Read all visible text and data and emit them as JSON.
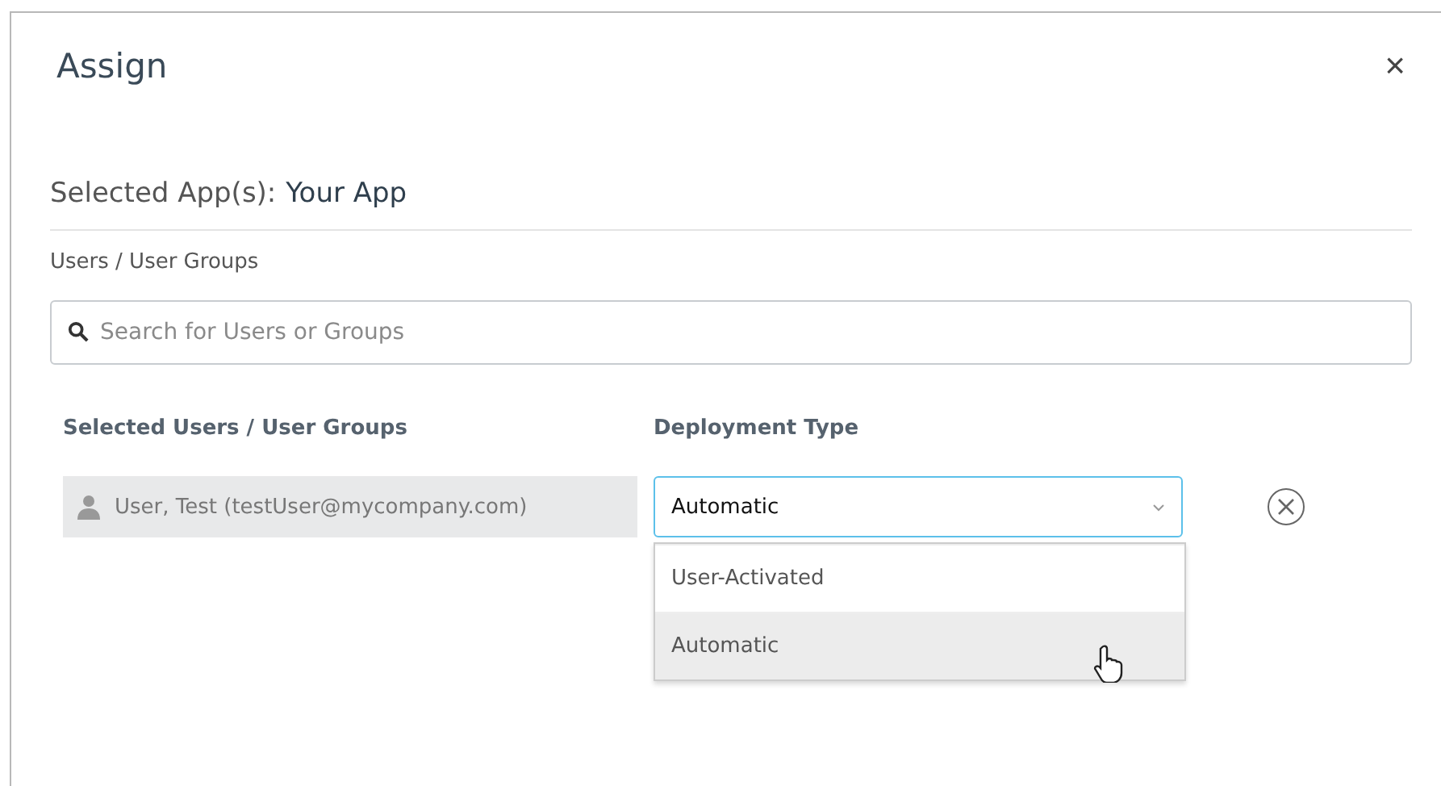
{
  "dialog": {
    "title": "Assign",
    "close": "×"
  },
  "selected_apps": {
    "label": "Selected App(s):",
    "value": "Your App"
  },
  "users_label": "Users / User Groups",
  "search": {
    "placeholder": "Search for Users or Groups"
  },
  "columns": [
    "Selected Users / User Groups",
    "Deployment Type"
  ],
  "assignments": [
    {
      "user": "User, Test (testUser@mycompany.com)",
      "deployment": "Automatic",
      "expanded": true,
      "options": [
        {
          "label": "User-Activated",
          "selected": false
        },
        {
          "label": "Automatic",
          "selected": true
        }
      ]
    }
  ]
}
